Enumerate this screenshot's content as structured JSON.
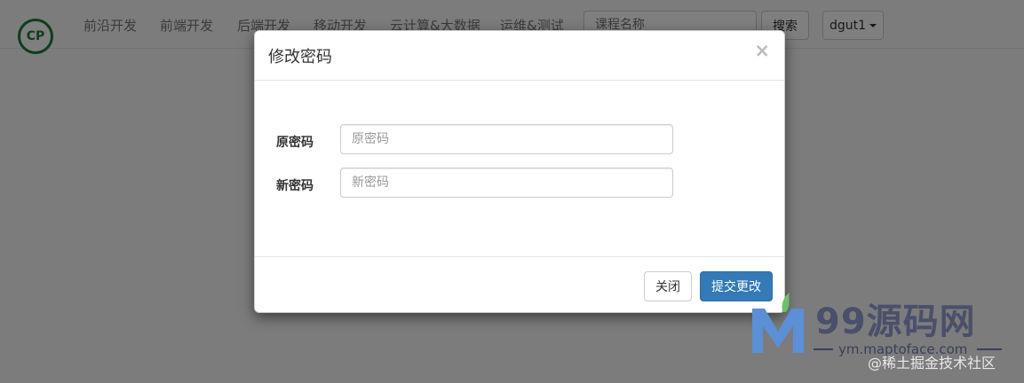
{
  "navbar": {
    "logo_text": "CP",
    "items": [
      {
        "label": "前沿开发"
      },
      {
        "label": "前端开发"
      },
      {
        "label": "后端开发"
      },
      {
        "label": "移动开发"
      },
      {
        "label": "云计算&大数据"
      },
      {
        "label": "运维&测试"
      }
    ],
    "search_placeholder": "课程名称",
    "search_button": "搜索",
    "user_label": "dgut1"
  },
  "modal": {
    "title": "修改密码",
    "close_symbol": "×",
    "fields": [
      {
        "label": "原密码",
        "placeholder": "原密码",
        "value": ""
      },
      {
        "label": "新密码",
        "placeholder": "新密码",
        "value": ""
      }
    ],
    "close_button": "关闭",
    "submit_button": "提交更改"
  },
  "watermark": {
    "brand": "99源码网",
    "url": "ym.maptoface.com",
    "credit": "@稀土掘金技术社区"
  },
  "colors": {
    "primary": "#337ab7",
    "logo_green": "#1f7a3a",
    "backdrop": "rgba(0,0,0,0.5)"
  }
}
